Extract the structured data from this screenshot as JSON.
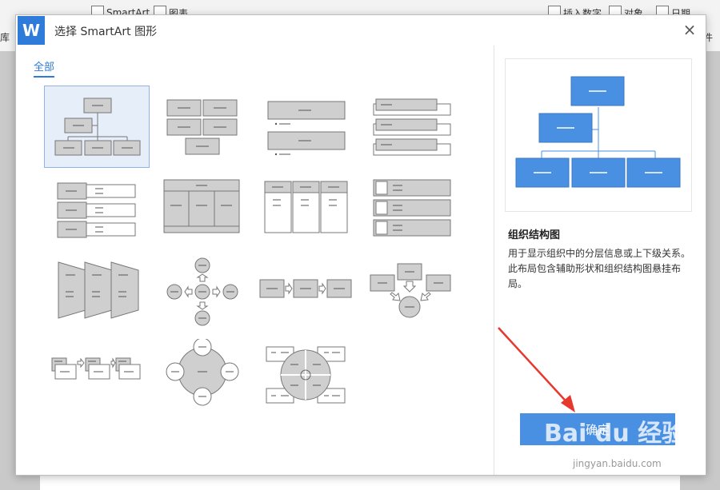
{
  "toolbar": {
    "smartart": "SmartArt",
    "chart": "图表",
    "insert_number": "插入数字",
    "object": "对象",
    "date": "日期",
    "left_frag": "库",
    "right_frag": "件"
  },
  "dialog": {
    "title": "选择 SmartArt 图形",
    "close_glyph": "×",
    "category": "全部",
    "dash": "—",
    "preview_title": "组织结构图",
    "preview_desc": "用于显示组织中的分层信息或上下级关系。此布局包含辅助形状和组织结构图悬挂布局。",
    "ok_label": "确定"
  },
  "watermark": {
    "main": "Bai du 经验",
    "sub": "jingyan.baidu.com"
  },
  "colors": {
    "accent": "#2f7bd9",
    "button": "#4a90e2",
    "preview_box": "#4a90e2",
    "thumb_box": "#cfcfcf"
  }
}
